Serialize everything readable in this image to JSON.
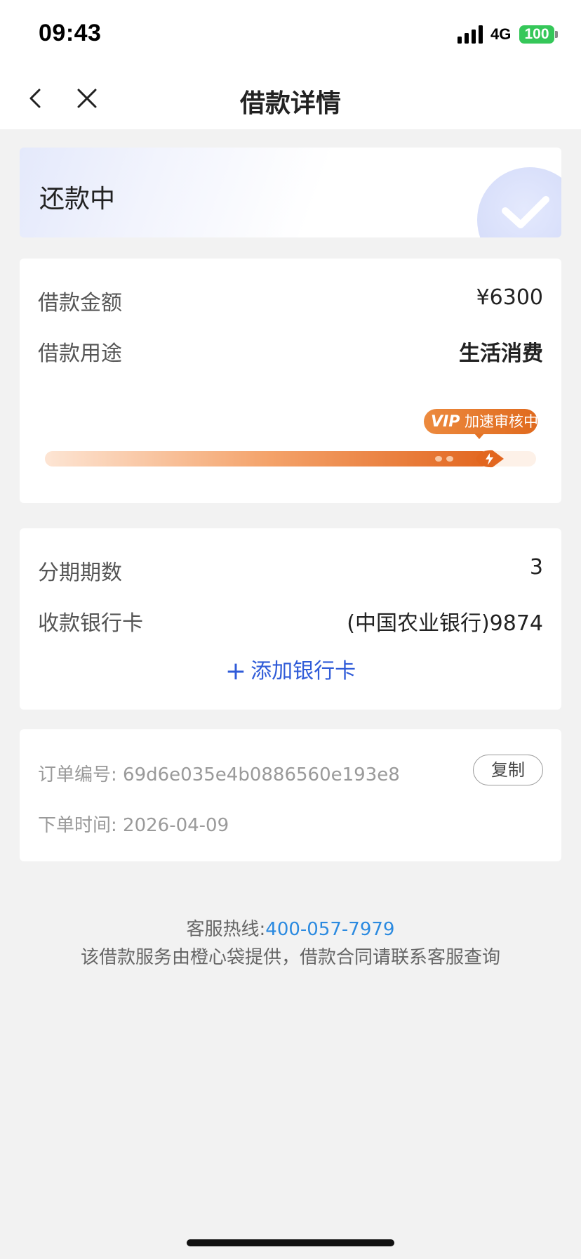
{
  "status_bar": {
    "time": "09:43",
    "network": "4G",
    "battery": "100",
    "battery_color": "#35c759",
    "icons": [
      "signal-icon",
      "battery-icon"
    ]
  },
  "nav": {
    "title": "借款详情",
    "back_icon": "chevron-left-icon",
    "close_icon": "close-icon"
  },
  "status_card": {
    "label": "还款中",
    "icon": "check-icon"
  },
  "loan": {
    "amount_label": "借款金额",
    "amount_value": "¥6300",
    "purpose_label": "借款用途",
    "purpose_value": "生活消费",
    "badge_vip": "VIP",
    "badge_text": "加速审核中",
    "progress": 0.92,
    "accent_color": "#e2661f"
  },
  "installment": {
    "periods_label": "分期期数",
    "periods_value": "3",
    "bank_label": "收款银行卡",
    "bank_value": "(中国农业银行)9874",
    "add_card_plus": "+",
    "add_card_label": "添加银行卡",
    "link_color": "#2f5bd8"
  },
  "order": {
    "number_label": "订单编号:",
    "number_value": "69d6e035e4b0886560e193e8",
    "copy_label": "复制",
    "time_label": "下单时间:",
    "time_value": "2026-04-09"
  },
  "footer": {
    "hotline_label": "客服热线:",
    "hotline_number": "400-057-7979",
    "note": "该借款服务由橙心袋提供，借款合同请联系客服查询"
  }
}
